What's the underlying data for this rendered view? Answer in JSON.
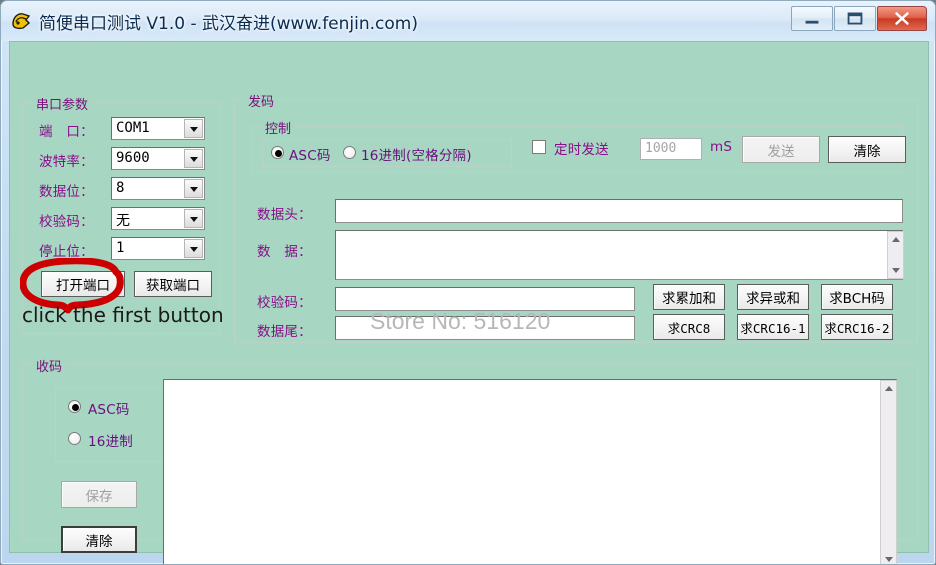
{
  "window": {
    "title": "简便串口测试 V1.0 - 武汉奋进(www.fenjin.com)",
    "icon": "app-icon",
    "minimize_label": "—",
    "maximize_label": "❐",
    "close_label": "✕",
    "client_bg": "#a7d7c2",
    "label_color": "#8a0d8a",
    "frame_color": "#cfe2f5"
  },
  "serial": {
    "group_title": "串口参数",
    "fields": [
      {
        "label": "端　口：",
        "value": "COM1"
      },
      {
        "label": "波特率：",
        "value": "9600"
      },
      {
        "label": "数据位：",
        "value": "8"
      },
      {
        "label": "校验码：",
        "value": "无"
      },
      {
        "label": "停止位：",
        "value": "1"
      }
    ],
    "open_port_label": "打开端口",
    "get_port_label": "获取端口"
  },
  "send": {
    "group_title": "发码",
    "control_group_title": "控制",
    "format_options": [
      {
        "label": "ASC码",
        "selected": true
      },
      {
        "label": "16进制(空格分隔)",
        "selected": false
      }
    ],
    "timed_send_label": "定时发送",
    "timed_send_checked": false,
    "interval_value": "1000",
    "interval_unit": "mS",
    "send_label": "发送",
    "send_disabled": true,
    "clear_label": "清除",
    "fields": [
      {
        "label": "数据头：",
        "value": ""
      },
      {
        "label": "数　据：",
        "value": ""
      },
      {
        "label": "校验码：",
        "value": ""
      },
      {
        "label": "数据尾：",
        "value": ""
      }
    ],
    "checksum_buttons_row1": [
      "求累加和",
      "求异或和",
      "求BCH码"
    ],
    "checksum_buttons_row2": [
      "求CRC8",
      "求CRC16-1",
      "求CRC16-2"
    ]
  },
  "receive": {
    "group_title": "收码",
    "format_options": [
      {
        "label": "ASC码",
        "selected": true
      },
      {
        "label": "16进制",
        "selected": false
      }
    ],
    "save_label": "保存",
    "save_disabled": true,
    "clear_label": "清除",
    "content": ""
  },
  "annotation": {
    "text": "click the first button",
    "circle_color": "#cc0000"
  },
  "watermark": {
    "text": "Store No: 516120"
  }
}
